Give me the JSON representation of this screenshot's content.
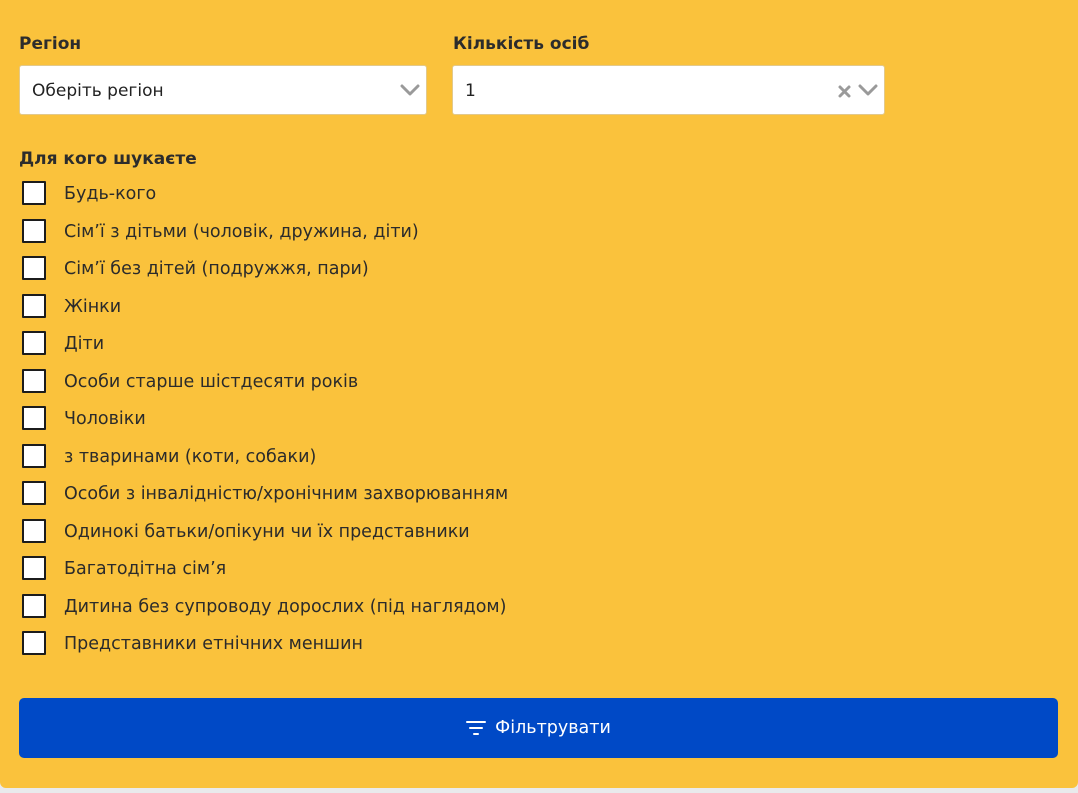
{
  "region": {
    "label": "Регіон",
    "value": "Оберіть регіон"
  },
  "persons": {
    "label": "Кількість осіб",
    "value": "1"
  },
  "audience": {
    "title": "Для кого шукаєте",
    "options": [
      {
        "label": "Будь-кого",
        "checked": false
      },
      {
        "label": "Сім’ї з дітьми (чоловік, дружина, діти)",
        "checked": false
      },
      {
        "label": "Сім’ї без дітей (подружжя, пари)",
        "checked": false
      },
      {
        "label": "Жінки",
        "checked": false
      },
      {
        "label": "Діти",
        "checked": false
      },
      {
        "label": "Особи старше шістдесяти років",
        "checked": false
      },
      {
        "label": "Чоловіки",
        "checked": false
      },
      {
        "label": "з тваринами (коти, собаки)",
        "checked": false
      },
      {
        "label": "Особи з інвалідністю/хронічним захворюванням",
        "checked": false
      },
      {
        "label": "Одинокі батьки/опікуни чи їх представники",
        "checked": false
      },
      {
        "label": "Багатодітна сім’я",
        "checked": false
      },
      {
        "label": "Дитина без супроводу дорослих (під наглядом)",
        "checked": false
      },
      {
        "label": "Представники етнічних меншин",
        "checked": false
      }
    ]
  },
  "filter_button": {
    "label": "Фільтрувати",
    "icon": "filter-icon"
  },
  "colors": {
    "panel": "#fac23c",
    "button": "#0049c6"
  }
}
